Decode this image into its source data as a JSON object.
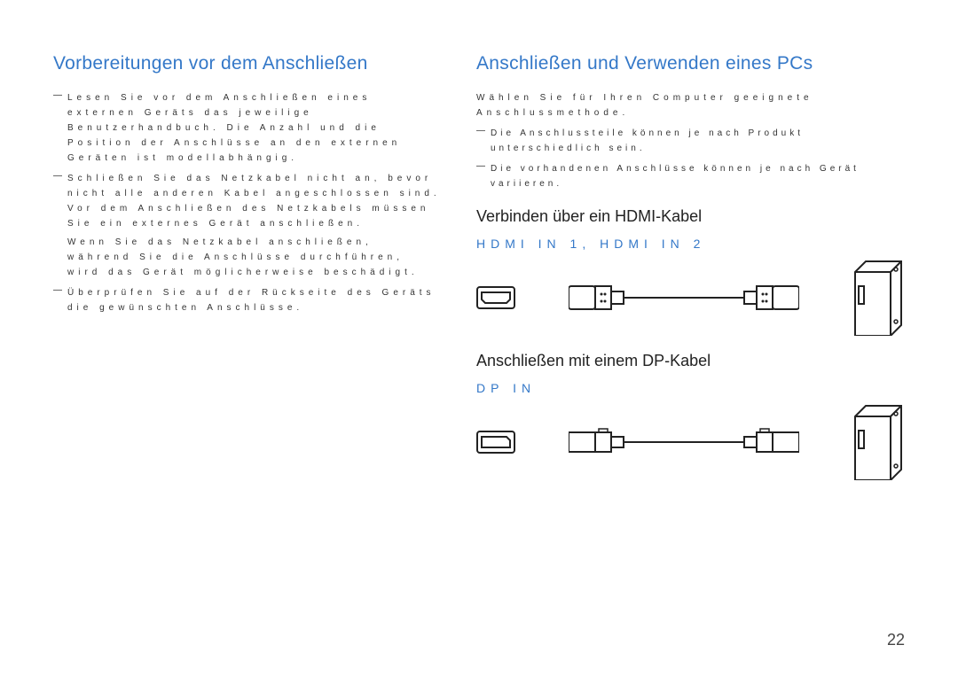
{
  "pageNumber": "22",
  "left": {
    "heading": "Vorbereitungen vor dem Anschließen",
    "items": [
      {
        "main": "Lesen Sie vor dem Anschließen eines externen Geräts das jeweilige Benutzerhandbuch. Die Anzahl und die Position der Anschlüsse an den externen Geräten ist modellabhängig."
      },
      {
        "main": "Schließen Sie das Netzkabel nicht an, bevor nicht alle anderen Kabel angeschlossen sind. Vor dem Anschließen des Netzkabels müssen Sie ein externes Gerät anschließen.",
        "sub": "Wenn Sie das Netzkabel anschließen, während Sie die Anschlüsse durchführen, wird das Gerät möglicherweise beschädigt."
      },
      {
        "main": "Überprüfen Sie auf der Rückseite des Geräts die gewünschten Anschlüsse."
      }
    ]
  },
  "right": {
    "heading": "Anschließen und Verwenden eines PCs",
    "intro": "Wählen Sie für Ihren Computer geeignete Anschlussmethode.",
    "notes": [
      "Die Anschlussteile können je nach Produkt unterschiedlich sein.",
      "Die vorhandenen Anschlüsse können je nach Gerät variieren."
    ],
    "hdmi": {
      "title": "Verbinden über ein HDMI-Kabel",
      "portLabel": "HDMI IN 1, HDMI IN 2"
    },
    "dp": {
      "title": "Anschließen mit einem DP-Kabel",
      "portLabel": "DP IN"
    }
  }
}
